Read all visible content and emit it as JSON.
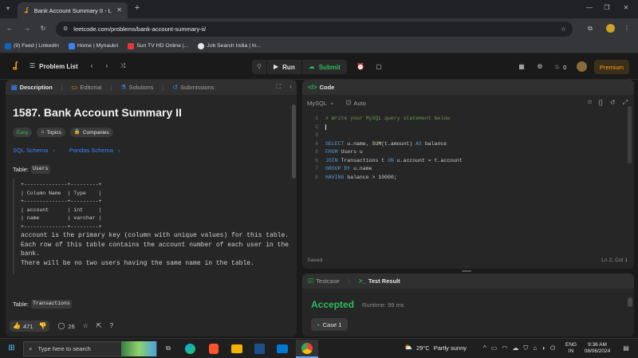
{
  "browser": {
    "tab_title": "Bank Account Summary II - Le",
    "url": "leetcode.com/problems/bank-account-summary-ii/",
    "bookmarks": [
      {
        "label": "(9) Feed | LinkedIn",
        "color": "#0a66c2"
      },
      {
        "label": "Home | Mynaukri",
        "color": "#3b82f6"
      },
      {
        "label": "Sun TV HD Online |...",
        "color": "#e53935"
      },
      {
        "label": "Job Search India | In...",
        "color": "#e6e6e6"
      }
    ]
  },
  "header": {
    "problem_list": "Problem List",
    "run": "Run",
    "submit": "Submit",
    "streak": "0",
    "premium": "Premium"
  },
  "left": {
    "tabs": [
      "Description",
      "Editorial",
      "Solutions",
      "Submissions"
    ],
    "title": "1587. Bank Account Summary II",
    "tags": [
      "Easy",
      "Topics",
      "Companies"
    ],
    "links": [
      "SQL Schema",
      "Pandas Schema"
    ],
    "table_label": "Table:",
    "table1_name": "Users",
    "schema_lines": [
      "+--------------+---------+",
      "| Column Name  | Type    |",
      "+--------------+---------+",
      "| account      | int     |",
      "| name         | varchar |",
      "+--------------+---------+"
    ],
    "desc_lines": [
      "account is the primary key (column with unique values) for this table.",
      "Each row of this table contains the account number of each user in the",
      "bank.",
      "There will be no two users having the same name in the table."
    ],
    "table2_name": "Transactions",
    "likes": "471",
    "comments": "26"
  },
  "editor": {
    "title": "Code",
    "language": "MySQL",
    "mode": "Auto",
    "line_numbers": [
      "1",
      "2",
      "3",
      "4",
      "5",
      "6",
      "7",
      "8"
    ],
    "status_left": "Saved",
    "status_right": "Ln 2, Col 1"
  },
  "result": {
    "tabs": [
      "Testcase",
      "Test Result"
    ],
    "verdict": "Accepted",
    "runtime": "Runtime: 99 ms",
    "case": "Case 1"
  },
  "taskbar": {
    "search_placeholder": "Type here to search",
    "weather_temp": "29°C",
    "weather_text": "Partly sunny",
    "lang1": "ENG",
    "lang2": "IN",
    "time": "9:36 AM",
    "date": "08/06/2024"
  }
}
